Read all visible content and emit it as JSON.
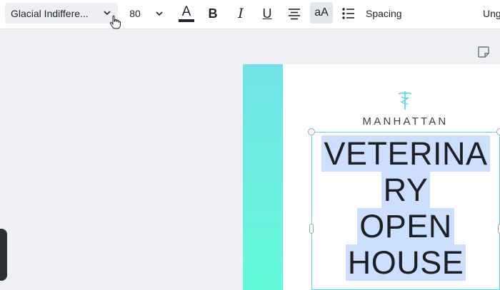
{
  "toolbar": {
    "font_name": "Glacial Indiffere...",
    "font_size": "80",
    "color_glyph": "A",
    "text_color": "#1f2329",
    "bold_glyph": "B",
    "italic_glyph": "I",
    "underline_glyph": "U",
    "case_glyph": "aA",
    "spacing_label": "Spacing",
    "ungroup_label": "Ung",
    "icons": [
      "chevron-down-icon",
      "hand-cursor-icon",
      "align-center-icon",
      "bullet-list-icon"
    ]
  },
  "canvas": {
    "brand": "MANHATTAN",
    "headline_lines": [
      "VETERINA",
      "RY",
      "OPEN",
      "HOUSE"
    ],
    "accent_color": "#6cf0df",
    "selection_color": "#5fd6dc",
    "icons": [
      "caduceus-icon",
      "sticky-note-icon"
    ]
  }
}
